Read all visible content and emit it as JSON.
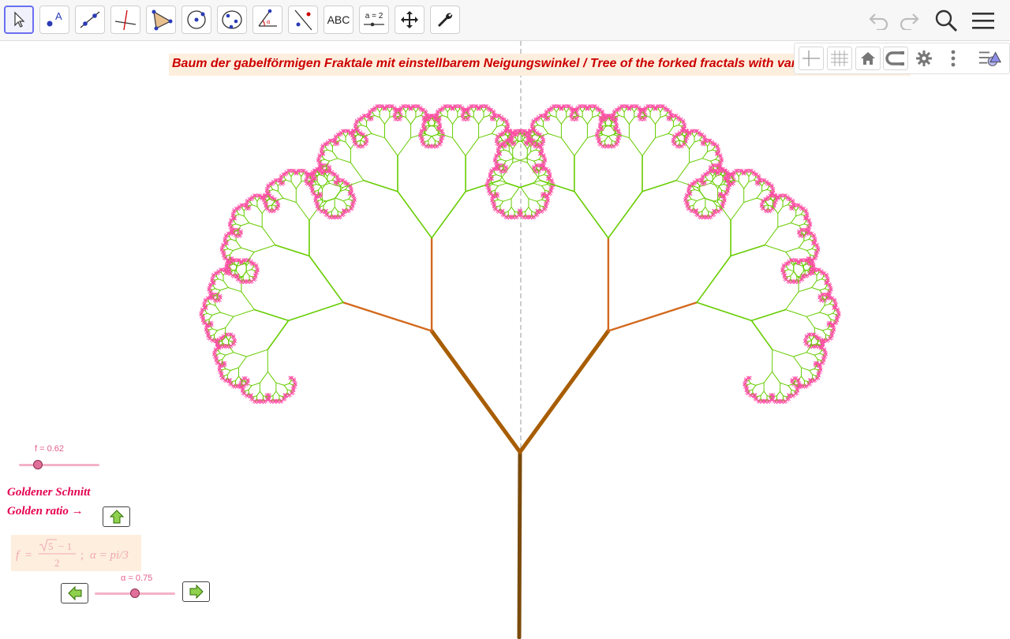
{
  "toolbar": {
    "tools": [
      {
        "name": "move",
        "icon": "cursor-arrow-icon"
      },
      {
        "name": "point",
        "icon": "point-icon",
        "letter": "A"
      },
      {
        "name": "line",
        "icon": "line-icon"
      },
      {
        "name": "perpendicular",
        "icon": "perpendicular-line-icon"
      },
      {
        "name": "polygon",
        "icon": "polygon-icon"
      },
      {
        "name": "circle",
        "icon": "circle-icon"
      },
      {
        "name": "conic",
        "icon": "ellipse-icon"
      },
      {
        "name": "angle",
        "icon": "angle-icon"
      },
      {
        "name": "reflect",
        "icon": "reflect-icon"
      },
      {
        "name": "text",
        "icon": "text-icon",
        "label": "ABC"
      },
      {
        "name": "slider",
        "icon": "slider-icon",
        "label": "a = 2"
      },
      {
        "name": "move-view",
        "icon": "move-graphics-icon"
      },
      {
        "name": "tools",
        "icon": "wrench-icon"
      }
    ],
    "right": [
      "undo-icon",
      "redo-icon",
      "search-icon",
      "menu-icon"
    ]
  },
  "graphics_panel": [
    "axes-icon",
    "grid-icon",
    "home-icon",
    "snap-icon",
    "settings-icon",
    "more-icon",
    "style-bar-icon"
  ],
  "title": "Baum der gabelförmigen Fraktale mit einstellbarem Neigungswinkel / Tree of the forked fractals with var",
  "slider_f": {
    "label": "f = 0.62",
    "value": 0.62,
    "min": 0.5,
    "max": 1.0
  },
  "slider_alpha": {
    "label": "α = 0.75",
    "value": 0.75,
    "min": 0.0,
    "max": 1.5
  },
  "golden": {
    "line1": "Goldener Schnitt",
    "line2": "Golden ratio →"
  },
  "formula": {
    "f": "f",
    "eq": "=",
    "sqrt_arg": "5",
    "minus_one": "− 1",
    "denominator": "2",
    "sep": ";",
    "alpha": "α = pi/3"
  },
  "colors": {
    "title_text": "#cc0000",
    "title_bg": "#fdeede",
    "trunk": "#7a4a0a",
    "branch2": "#a85d00",
    "branch3": "#d2691e",
    "leaf_lines": "#66cc00",
    "tips": "#ff4da6",
    "accent": "#6b6ff2"
  }
}
